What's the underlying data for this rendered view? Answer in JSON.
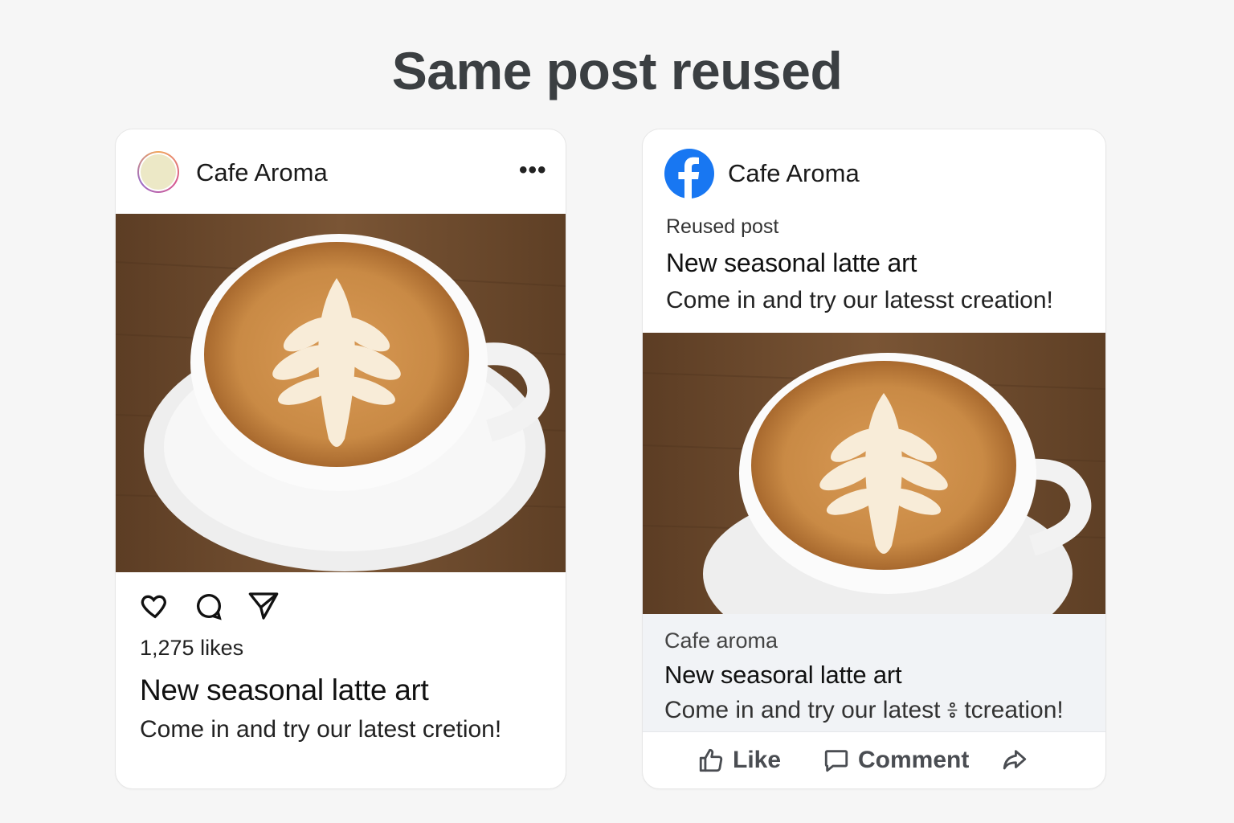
{
  "heading": "Same post reused",
  "instagram": {
    "account_name": "Cafe Aroma",
    "more_label": "•••",
    "photo": "latte-art-photo",
    "likes": "1,275 likes",
    "post_title": "New seasonal latte art",
    "caption": "Come in and try our latest cretion!"
  },
  "facebook": {
    "account_name": "Cafe Aroma",
    "post_label": "Reused post",
    "headline": "New seasonal latte art",
    "text": "Come in and try our latesst creation!",
    "photo": "latte-art-photo",
    "link_source": "Cafe aroma",
    "link_title": "New seasoral latte art",
    "link_description": "Come in and try our latest ៖ tcreation!",
    "actions": {
      "like": "Like",
      "comment": "Comment"
    }
  },
  "colors": {
    "facebook_blue": "#1877f2",
    "coffee_crema": "#c98a45",
    "table_wood": "#6b4a2c"
  }
}
